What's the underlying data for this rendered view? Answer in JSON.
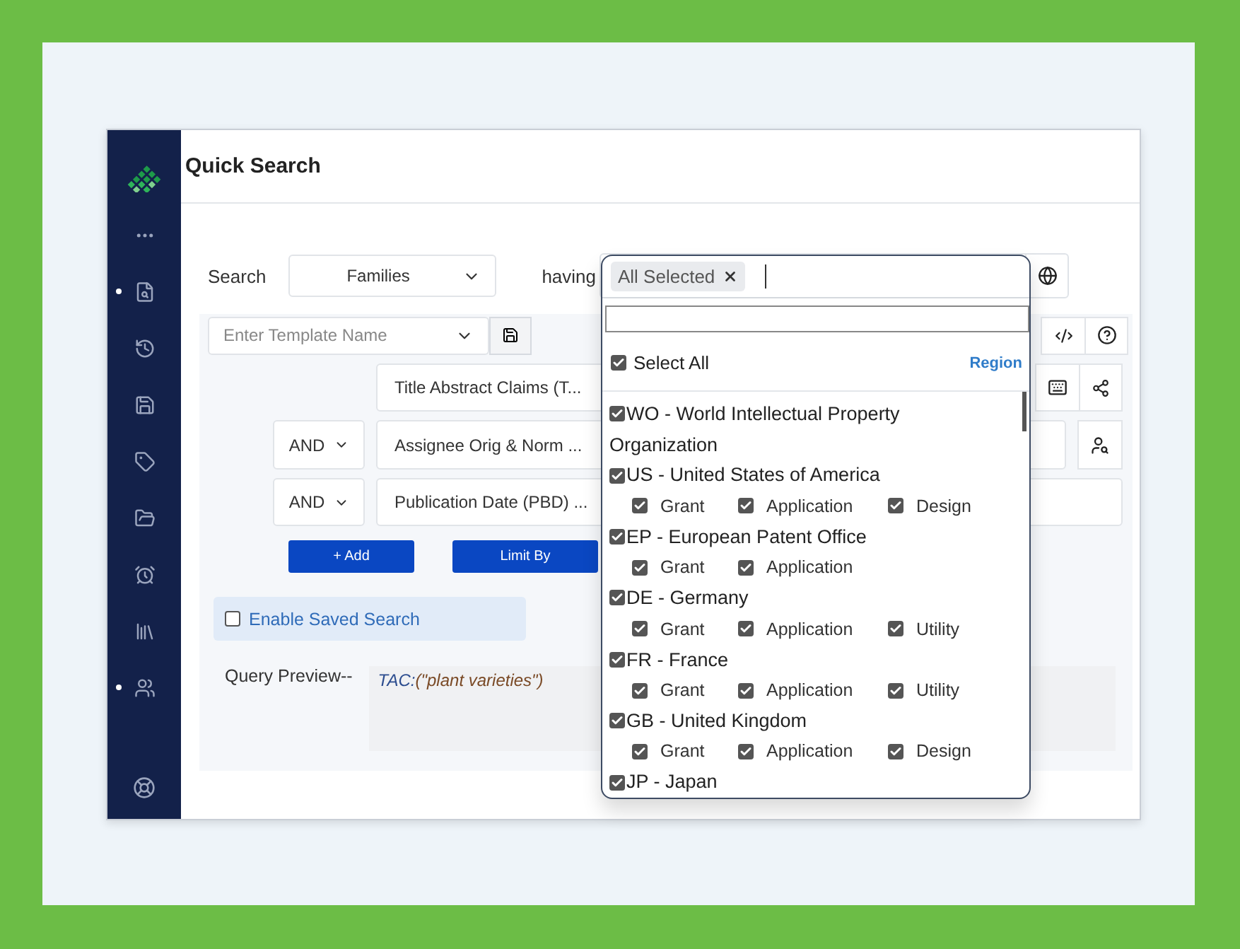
{
  "window": {
    "title": "Quick Search"
  },
  "sidebar": {
    "items": [
      {
        "kind": "more",
        "dot": false
      },
      {
        "kind": "document",
        "dot": true
      },
      {
        "kind": "history",
        "dot": false
      },
      {
        "kind": "save",
        "dot": false
      },
      {
        "kind": "tag",
        "dot": false
      },
      {
        "kind": "folder",
        "dot": false
      },
      {
        "kind": "alarm",
        "dot": false
      },
      {
        "kind": "library",
        "dot": false
      },
      {
        "kind": "team",
        "dot": true
      }
    ]
  },
  "search": {
    "label": "Search",
    "scope": "Families",
    "having_label": "having"
  },
  "template": {
    "placeholder": "Enter Template Name"
  },
  "rows": [
    {
      "field": "Title Abstract Claims (T..."
    },
    {
      "operator": "AND",
      "field": "Assignee Orig & Norm ..."
    },
    {
      "operator": "AND",
      "field": "Publication Date (PBD) ..."
    }
  ],
  "buttons": [
    "+ Add",
    "Limit By"
  ],
  "saved_search": {
    "label": "Enable Saved Search",
    "checked": false
  },
  "query_preview": {
    "label": "Query Preview--",
    "field": "TAC:",
    "value": "(\"plant varieties\")"
  },
  "region_dropdown": {
    "tag": "All Selected",
    "select_all": {
      "label": "Select All",
      "checked": true
    },
    "link": "Region",
    "regions": [
      {
        "label": "WO - World Intellectual Property Organization",
        "checked": true
      },
      {
        "label": "US - United States of America",
        "checked": true,
        "types": [
          {
            "label": "Grant",
            "checked": true
          },
          {
            "label": "Application",
            "checked": true
          },
          {
            "label": "Design",
            "checked": true
          }
        ]
      },
      {
        "label": "EP - European Patent Office",
        "checked": true,
        "types": [
          {
            "label": "Grant",
            "checked": true
          },
          {
            "label": "Application",
            "checked": true
          }
        ]
      },
      {
        "label": "DE - Germany",
        "checked": true,
        "types": [
          {
            "label": "Grant",
            "checked": true
          },
          {
            "label": "Application",
            "checked": true
          },
          {
            "label": "Utility",
            "checked": true
          }
        ]
      },
      {
        "label": "FR - France",
        "checked": true,
        "types": [
          {
            "label": "Grant",
            "checked": true
          },
          {
            "label": "Application",
            "checked": true
          },
          {
            "label": "Utility",
            "checked": true
          }
        ]
      },
      {
        "label": "GB - United Kingdom",
        "checked": true,
        "types": [
          {
            "label": "Grant",
            "checked": true
          },
          {
            "label": "Application",
            "checked": true
          },
          {
            "label": "Design",
            "checked": true
          }
        ]
      },
      {
        "label": "JP - Japan",
        "checked": true
      }
    ]
  }
}
